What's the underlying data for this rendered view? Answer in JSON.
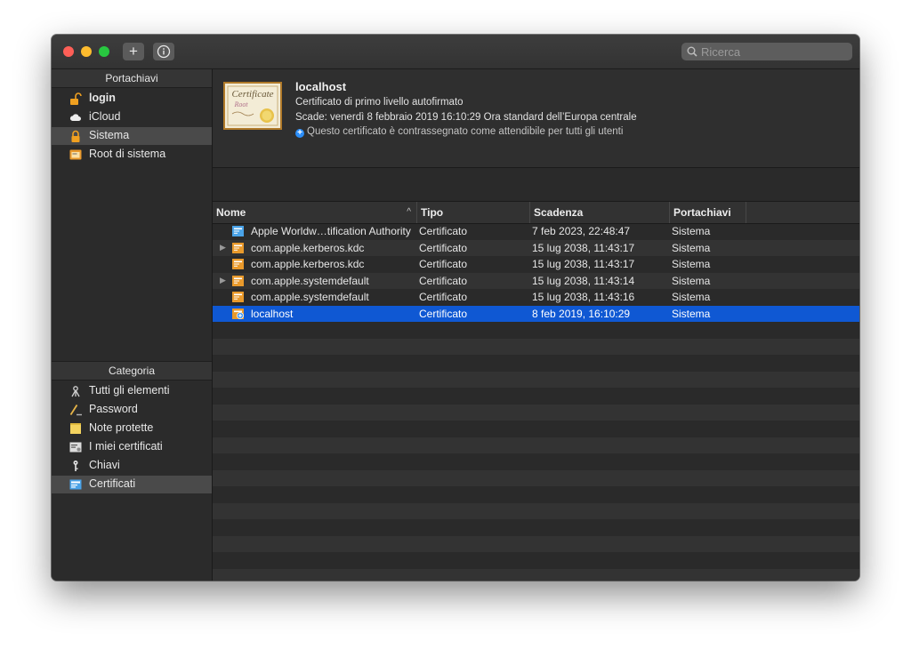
{
  "search": {
    "placeholder": "Ricerca"
  },
  "sidebar": {
    "keychains_header": "Portachiavi",
    "keychains": [
      {
        "label": "login",
        "icon": "unlocked-padlock-icon"
      },
      {
        "label": "iCloud",
        "icon": "cloud-icon"
      },
      {
        "label": "Sistema",
        "icon": "locked-padlock-icon"
      },
      {
        "label": "Root di sistema",
        "icon": "folder-certificates-icon"
      }
    ],
    "categories_header": "Categoria",
    "categories": [
      {
        "label": "Tutti gli elementi",
        "icon": "all-items-icon"
      },
      {
        "label": "Password",
        "icon": "password-icon"
      },
      {
        "label": "Note protette",
        "icon": "secure-note-icon"
      },
      {
        "label": "I miei certificati",
        "icon": "my-certificates-icon"
      },
      {
        "label": "Chiavi",
        "icon": "key-icon"
      },
      {
        "label": "Certificati",
        "icon": "certificates-icon"
      }
    ]
  },
  "detail": {
    "image_text": "Certificate",
    "image_subtext": "Root",
    "title": "localhost",
    "subtitle": "Certificato di primo livello autofirmato",
    "expiry": "Scade: venerdì 8 febbraio 2019 16:10:29 Ora standard dell’Europa centrale",
    "trust": "Questo certificato è contrassegnato come attendibile per tutti gli utenti"
  },
  "table": {
    "columns": [
      "Nome",
      "Tipo",
      "Scadenza",
      "Portachiavi"
    ],
    "rows": [
      {
        "name": "Apple Worldw…tification Authority",
        "type": "Certificato",
        "expiry": "7 feb 2023, 22:48:47",
        "keychain": "Sistema"
      },
      {
        "name": "com.apple.kerberos.kdc",
        "type": "Certificato",
        "expiry": "15 lug 2038, 11:43:17",
        "keychain": "Sistema"
      },
      {
        "name": "com.apple.kerberos.kdc",
        "type": "Certificato",
        "expiry": "15 lug 2038, 11:43:17",
        "keychain": "Sistema"
      },
      {
        "name": "com.apple.systemdefault",
        "type": "Certificato",
        "expiry": "15 lug 2038, 11:43:14",
        "keychain": "Sistema"
      },
      {
        "name": "com.apple.systemdefault",
        "type": "Certificato",
        "expiry": "15 lug 2038, 11:43:16",
        "keychain": "Sistema"
      },
      {
        "name": "localhost",
        "type": "Certificato",
        "expiry": "8 feb 2019, 16:10:29",
        "keychain": "Sistema"
      }
    ]
  },
  "colors": {
    "selection": "#0f58d3",
    "background": "#2a2a2a"
  }
}
